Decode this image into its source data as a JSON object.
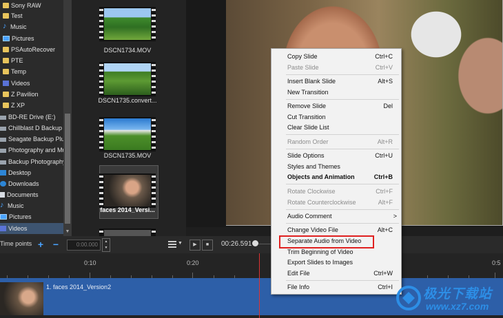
{
  "folder_tree": {
    "items": [
      {
        "label": "Sony RAW",
        "icon": "folder-icon"
      },
      {
        "label": "Test",
        "icon": "folder-icon"
      },
      {
        "label": "Music",
        "icon": "music-icon"
      },
      {
        "label": "Pictures",
        "icon": "pictures-icon"
      },
      {
        "label": "PSAutoRecover",
        "icon": "folder-icon"
      },
      {
        "label": "PTE",
        "icon": "folder-icon"
      },
      {
        "label": "Temp",
        "icon": "folder-icon"
      },
      {
        "label": "Videos",
        "icon": "videos-icon"
      },
      {
        "label": "Z Pavilion",
        "icon": "folder-icon"
      },
      {
        "label": "Z XP",
        "icon": "folder-icon"
      },
      {
        "label": "BD-RE Drive (E:)",
        "icon": "drive-icon"
      },
      {
        "label": "Chillblast D Backup (F",
        "icon": "drive-icon"
      },
      {
        "label": "Seagate Backup Plus D",
        "icon": "drive-icon"
      },
      {
        "label": "Photography and Mus",
        "icon": "drive-icon"
      },
      {
        "label": "Backup Photography (",
        "icon": "drive-icon"
      },
      {
        "label": "Desktop",
        "icon": "desktop-icon"
      },
      {
        "label": "Downloads",
        "icon": "downloads-icon"
      },
      {
        "label": "Documents",
        "icon": "documents-icon"
      },
      {
        "label": "Music",
        "icon": "music-icon"
      },
      {
        "label": "Pictures",
        "icon": "pictures-icon"
      },
      {
        "label": "Videos",
        "icon": "videos-icon"
      }
    ],
    "selected_label": "Videos"
  },
  "files": [
    {
      "name": "DSCN1734.MOV"
    },
    {
      "name": "DSCN1735.convert..."
    },
    {
      "name": "DSCN1735.MOV"
    },
    {
      "name": "faces 2014_Versi..."
    }
  ],
  "toolbar": {
    "time_points_label": "Time points",
    "add_icon": "+",
    "remove_icon": "−",
    "time_input_value": "0:00.000",
    "current_time": "00:26.591"
  },
  "ruler": {
    "labels": [
      "0:10",
      "0:20",
      "0:5"
    ]
  },
  "track": {
    "label": "1. faces 2014_Version2"
  },
  "context_menu": {
    "items": [
      {
        "label": "Copy Slide",
        "shortcut": "Ctrl+C",
        "state": "enabled"
      },
      {
        "label": "Paste Slide",
        "shortcut": "Ctrl+V",
        "state": "disabled"
      },
      {
        "label": "Insert Blank Slide",
        "shortcut": "Alt+S",
        "state": "enabled"
      },
      {
        "label": "New Transition",
        "shortcut": "",
        "state": "enabled"
      },
      {
        "label": "Remove Slide",
        "shortcut": "Del",
        "state": "enabled"
      },
      {
        "label": "Cut Transition",
        "shortcut": "",
        "state": "enabled"
      },
      {
        "label": "Clear Slide List",
        "shortcut": "",
        "state": "enabled"
      },
      {
        "label": "Random Order",
        "shortcut": "Alt+R",
        "state": "disabled"
      },
      {
        "label": "Slide Options",
        "shortcut": "Ctrl+U",
        "state": "enabled"
      },
      {
        "label": "Styles and Themes",
        "shortcut": "",
        "state": "enabled"
      },
      {
        "label": "Objects and Animation",
        "shortcut": "Ctrl+B",
        "state": "bold"
      },
      {
        "label": "Rotate Clockwise",
        "shortcut": "Ctrl+F",
        "state": "disabled"
      },
      {
        "label": "Rotate Counterclockwise",
        "shortcut": "Alt+F",
        "state": "disabled"
      },
      {
        "label": "Audio Comment",
        "shortcut": ">",
        "state": "enabled"
      },
      {
        "label": "Change Video File",
        "shortcut": "Alt+C",
        "state": "enabled"
      },
      {
        "label": "Separate Audio from Video",
        "shortcut": "",
        "state": "enabled"
      },
      {
        "label": "Trim Beginning of Video",
        "shortcut": "",
        "state": "enabled"
      },
      {
        "label": "Export Slides to Images",
        "shortcut": "",
        "state": "enabled"
      },
      {
        "label": "Edit File",
        "shortcut": "Ctrl+W",
        "state": "enabled"
      },
      {
        "label": "File Info",
        "shortcut": "Ctrl+I",
        "state": "enabled"
      }
    ],
    "highlighted_label": "Separate Audio from Video",
    "highlight_color": "#e0201f"
  },
  "watermark": {
    "text": "极光下载站",
    "url": "www.xz7.com"
  },
  "colors": {
    "accent_blue": "#4aa3ff",
    "track_blue": "#2d5fa8",
    "playhead_red": "#dd3333"
  }
}
